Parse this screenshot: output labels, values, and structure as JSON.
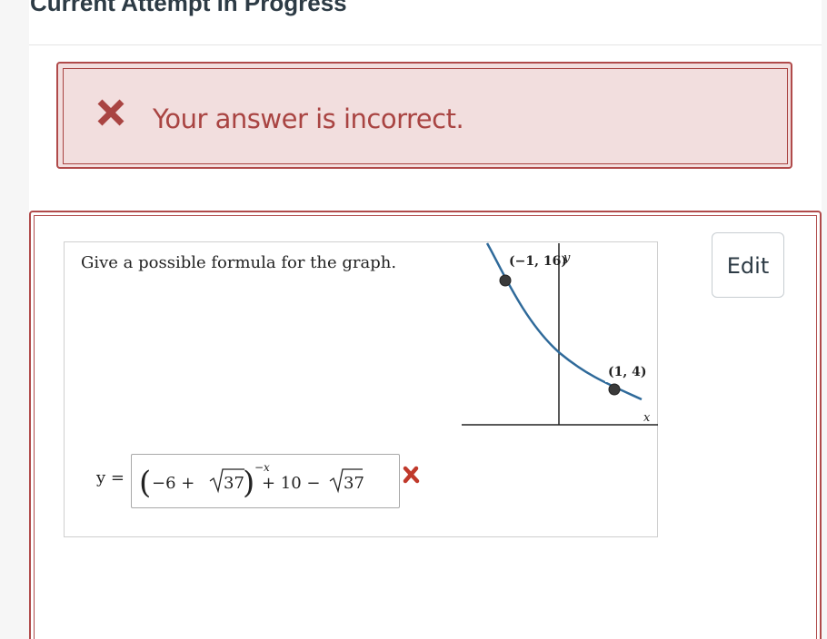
{
  "page": {
    "title": "Current Attempt in Progress"
  },
  "feedback": {
    "message": "Your answer is incorrect.",
    "icon": "x-icon",
    "color": "#a94442"
  },
  "question": {
    "prompt": "Give a possible formula for the graph.",
    "edit_label": "Edit",
    "equation_lhs": "y =",
    "answer": {
      "open_paren": "(",
      "minus_six_plus": "−6 + ",
      "radicand": "37",
      "close_paren": ")",
      "exponent": "−x",
      "plus_ten_minus": " + 10 − ",
      "radicand2": "37"
    },
    "result_icon": "wrong-x-icon"
  },
  "graph": {
    "point_a_label": "(−1, 16)",
    "point_b_label": "(1, 4)",
    "y_axis_label": "y",
    "x_axis_label": "x",
    "curve_color": "#2f6a9a",
    "point_color": "#3a3a3a",
    "points": [
      {
        "x": -1,
        "y": 16
      },
      {
        "x": 1,
        "y": 4
      }
    ]
  }
}
